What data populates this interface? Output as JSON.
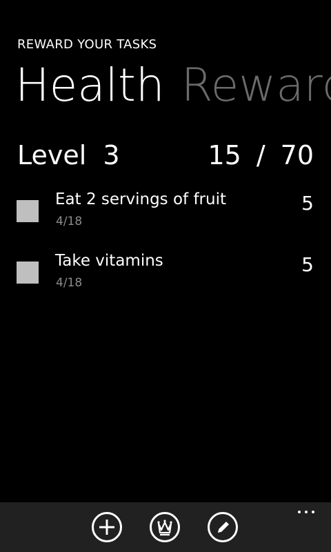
{
  "app": {
    "title": "REWARD YOUR TASKS"
  },
  "pivot": {
    "items": [
      {
        "label": "Health",
        "active": true
      },
      {
        "label": "Rewards",
        "active": false
      }
    ]
  },
  "level": {
    "label": "Level",
    "value": "3",
    "points_current": "15",
    "separator": "/",
    "points_total": "70"
  },
  "tasks": [
    {
      "title": "Eat 2 servings of fruit",
      "date": "4/18",
      "points": "5",
      "checked": false
    },
    {
      "title": "Take vitamins",
      "date": "4/18",
      "points": "5",
      "checked": false
    }
  ],
  "app_bar": {
    "buttons": [
      {
        "icon": "add-icon"
      },
      {
        "icon": "crown-icon"
      },
      {
        "icon": "pencil-icon"
      }
    ],
    "more_icon": "ellipsis-icon"
  },
  "colors": {
    "background": "#000000",
    "text": "#ffffff",
    "inactive_pivot": "#6b6b6b",
    "secondary_text": "#8c8c8c",
    "checkbox": "#bfbfbf",
    "app_bar": "#212121"
  }
}
